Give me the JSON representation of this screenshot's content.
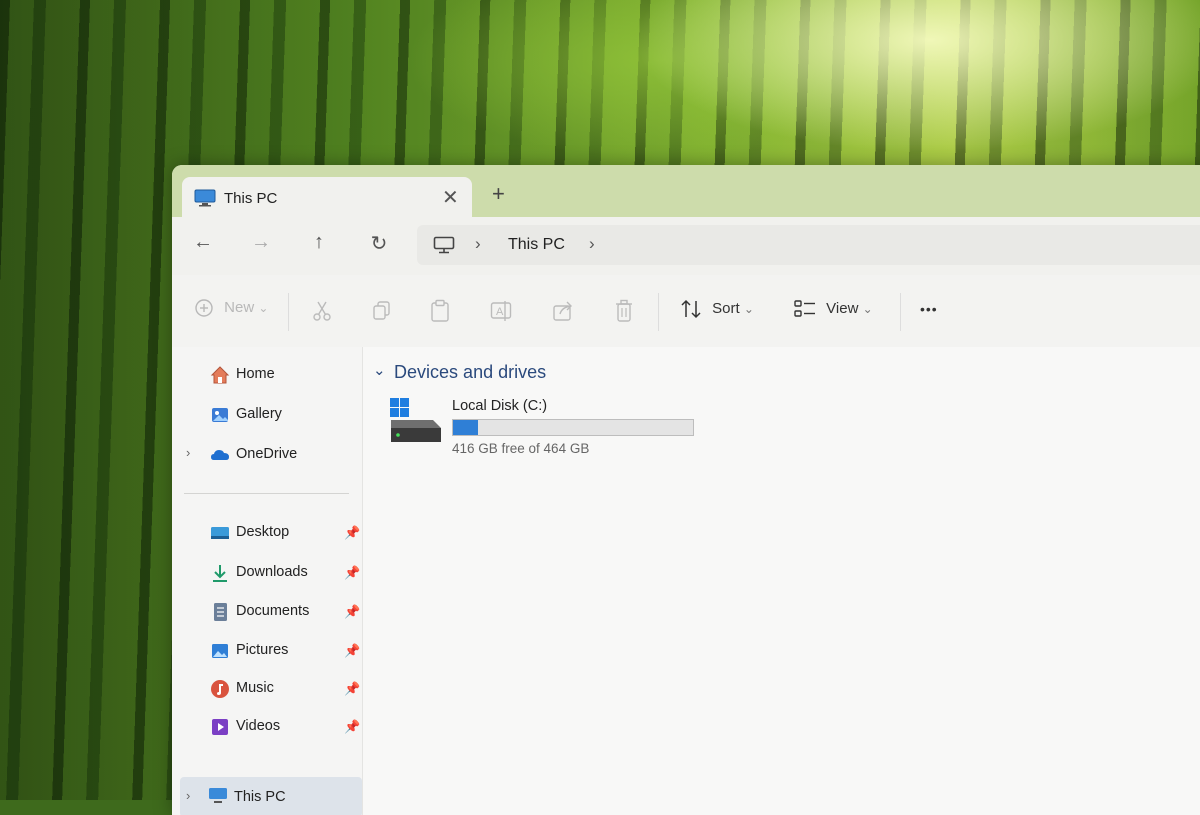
{
  "window": {
    "tab_title": "This PC",
    "close_tab_glyph": "✕",
    "new_tab_glyph": "+"
  },
  "nav": {
    "back_glyph": "←",
    "forward_glyph": "→",
    "up_glyph": "↑",
    "refresh_glyph": "↻",
    "separator_glyph": "›",
    "breadcrumb": "This PC"
  },
  "commands": {
    "new_label": "New",
    "sort_label": "Sort",
    "view_label": "View",
    "more_glyph": "•••",
    "dropdown_glyph": "⌄"
  },
  "sidebar": {
    "top_items": [
      {
        "label": "Home",
        "icon": "home-icon"
      },
      {
        "label": "Gallery",
        "icon": "gallery-icon"
      },
      {
        "label": "OneDrive",
        "icon": "cloud-icon"
      }
    ],
    "pinned_items": [
      {
        "label": "Desktop",
        "icon": "desktop-icon"
      },
      {
        "label": "Downloads",
        "icon": "download-icon"
      },
      {
        "label": "Documents",
        "icon": "documents-icon"
      },
      {
        "label": "Pictures",
        "icon": "pictures-icon"
      },
      {
        "label": "Music",
        "icon": "music-icon"
      },
      {
        "label": "Videos",
        "icon": "videos-icon"
      }
    ],
    "this_pc_label": "This PC",
    "expand_glyph": "›",
    "pin_glyph": "📌"
  },
  "content": {
    "group_label": "Devices and drives",
    "group_chevron": "⌄",
    "drive": {
      "name": "Local Disk (C:)",
      "free_text": "416 GB free of 464 GB",
      "used_fraction": 0.103
    }
  },
  "colors": {
    "accent": "#2f7fd6",
    "group_header": "#2b4a7d",
    "tabstrip": "#cddcab"
  }
}
